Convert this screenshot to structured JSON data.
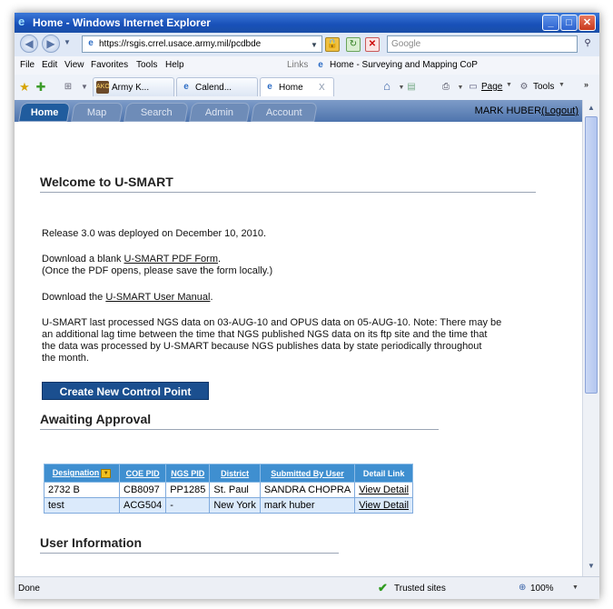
{
  "window": {
    "title": "Home - Windows Internet Explorer"
  },
  "address": {
    "url": "https://rsgis.crrel.usace.army.mil/pcdbde",
    "search_placeholder": "Google"
  },
  "links_bar": {
    "label": "Links",
    "item": "Home - Surveying and Mapping CoP"
  },
  "menu": [
    "File",
    "Edit",
    "View",
    "Favorites",
    "Tools",
    "Help"
  ],
  "browser_tabs": [
    {
      "label": "Army K..."
    },
    {
      "label": "Calend..."
    },
    {
      "label": "Home",
      "close": "X"
    }
  ],
  "command_bar": {
    "page": "Page",
    "tools": "Tools"
  },
  "site_nav": {
    "tabs": [
      "Home",
      "Map",
      "Search",
      "Admin",
      "Account"
    ],
    "user": "MARK HUBER",
    "logout": "(Logout)"
  },
  "welcome": {
    "heading": "Welcome to U-SMART",
    "release": "Release 3.0 was deployed on December 10, 2010.",
    "download_prefix": "Download a blank ",
    "pdf_link": "U-SMART PDF Form",
    "download_suffix": ".",
    "pdf_note": "(Once the PDF opens, please save the form locally.)",
    "manual_prefix": "Download the ",
    "manual_link": "U-SMART User Manual",
    "manual_suffix": ".",
    "ngs_1": "U-SMART last processed NGS data on 03-AUG-10 and OPUS data on 05-AUG-10. Note: There may be",
    "ngs_2": "an additional lag time between the time that NGS published NGS data on its ftp site and the time that",
    "ngs_3": "the data was processed by U-SMART because NGS publishes data by state periodically throughout",
    "ngs_4": "the month."
  },
  "create_button": "Create New Control Point",
  "approval": {
    "heading": "Awaiting Approval",
    "columns": [
      "Designation",
      "COE PID",
      "NGS PID",
      "District",
      "Submitted By User",
      "Detail Link"
    ],
    "rows": [
      [
        "2732 B",
        "CB8097",
        "PP1285",
        "St. Paul",
        "SANDRA CHOPRA",
        "View Detail"
      ],
      [
        "test",
        "ACG504",
        "-",
        "New York",
        "mark huber",
        "View Detail"
      ]
    ]
  },
  "user_info": {
    "heading": "User Information"
  },
  "status": {
    "left": "Done",
    "zone": "Trusted sites",
    "zoom": "100%"
  }
}
